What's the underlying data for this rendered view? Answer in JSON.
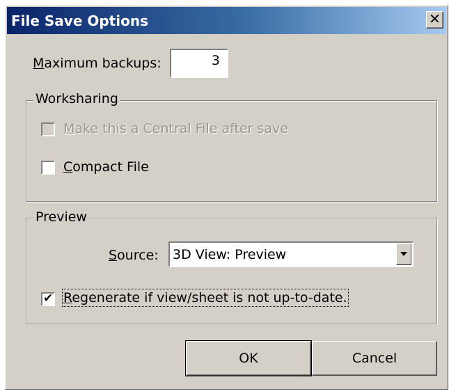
{
  "window": {
    "title": "File Save Options",
    "close_glyph": "✕",
    "titlebar_colors": [
      "#0a246a",
      "#a6caf0"
    ]
  },
  "backups": {
    "label_prefix": "M",
    "label_rest": "aximum backups:",
    "value": "3"
  },
  "worksharing": {
    "title": "Worksharing",
    "central_file": {
      "label_prefix": "M",
      "label_rest": "ake this a Central File after save",
      "checked": false,
      "enabled": false
    },
    "compact_file": {
      "label_prefix": "C",
      "label_rest": "ompact File",
      "checked": false,
      "enabled": true
    }
  },
  "preview": {
    "title": "Preview",
    "source_label_prefix": "S",
    "source_label_rest": "ource:",
    "source_value": "3D View: Preview",
    "regenerate": {
      "label_prefix": "R",
      "label_rest": "egenerate if view/sheet is not up-to-date.",
      "checked": true,
      "check_glyph": "✔"
    }
  },
  "buttons": {
    "ok": "OK",
    "cancel": "Cancel"
  },
  "icons": {
    "close": "close-icon",
    "dropdown": "chevron-down-icon",
    "check": "check-icon"
  }
}
